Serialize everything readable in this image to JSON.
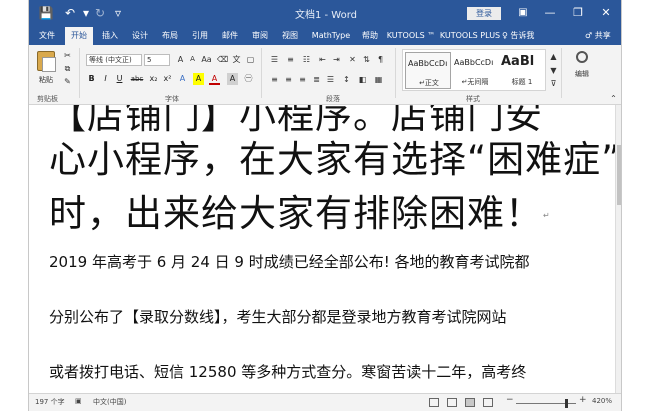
{
  "title_bar": {
    "doc_title": "文档1 - Word",
    "login": "登录",
    "save_icon": "save-icon",
    "undo_icon": "undo-icon",
    "redo_icon": "redo-icon",
    "ribbon_options_icon": "ribbon-display-icon",
    "minimize": "—",
    "restore": "❐",
    "close": "✕"
  },
  "tabs": [
    {
      "label": "文件"
    },
    {
      "label": "开始"
    },
    {
      "label": "插入"
    },
    {
      "label": "设计"
    },
    {
      "label": "布局"
    },
    {
      "label": "引用"
    },
    {
      "label": "邮件"
    },
    {
      "label": "审阅"
    },
    {
      "label": "视图"
    },
    {
      "label": "MathType"
    },
    {
      "label": "帮助"
    },
    {
      "label": "KUTOOLS ™"
    },
    {
      "label": "KUTOOLS PLUS"
    }
  ],
  "tell_me": "♀ 告诉我",
  "share": "♂ 共享",
  "ribbon": {
    "paste_label": "粘贴",
    "clipboard_group": "剪贴板",
    "font_name": "等线 (中文正)",
    "font_size": "5",
    "font_group": "字体",
    "paragraph_group": "段落",
    "styles_group": "样式",
    "styles": [
      {
        "sample": "AaBbCcDı",
        "name": "↵正文"
      },
      {
        "sample": "AaBbCcDı",
        "name": "↵无间隔"
      },
      {
        "sample": "AaBl",
        "name": "标题 1"
      }
    ],
    "edit_label": "编辑",
    "format_buttons": [
      "B",
      "I",
      "U",
      "abc",
      "x₂",
      "x²",
      "A",
      "A",
      "A",
      "A"
    ]
  },
  "document": {
    "heading_lines": [
      "【店铺门】小程序。店铺门安",
      "心小程序，在大家有选择“困难症”",
      "时，出来给大家有排除困难！"
    ],
    "body_lines": [
      "2019 年高考于 6 月 24 日 9 时成绩已经全部公布! 各地的教育考试院都",
      "分别公布了【录取分数线】，考生大部分都是登录地方教育考试院网站",
      "或者拨打电话、短信 12580 等多种方式查分。寒窗苦读十二年，高考终"
    ]
  },
  "status_bar": {
    "word_count": "197 个字",
    "language": "中文(中国)",
    "zoom_minus": "−",
    "zoom_plus": "+",
    "zoom": "420%"
  }
}
